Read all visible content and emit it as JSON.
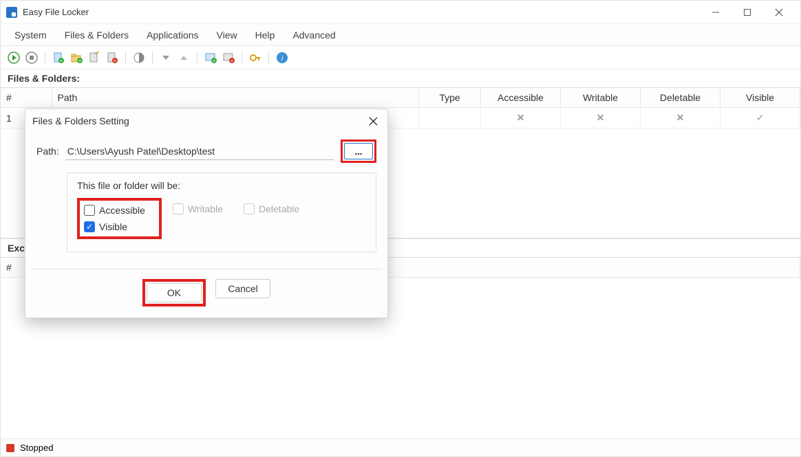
{
  "titlebar": {
    "title": "Easy File Locker"
  },
  "menubar": {
    "items": [
      "System",
      "Files & Folders",
      "Applications",
      "View",
      "Help",
      "Advanced"
    ]
  },
  "sections": {
    "files_label": "Files & Folders:",
    "excludes_label": "Exce"
  },
  "table": {
    "cols": {
      "num": "#",
      "path": "Path",
      "type": "Type",
      "accessible": "Accessible",
      "writable": "Writable",
      "deletable": "Deletable",
      "visible": "Visible"
    },
    "row1": {
      "num": "1",
      "accessible": "✕",
      "writable": "✕",
      "deletable": "✕",
      "visible": "✓"
    }
  },
  "excludes": {
    "cols": {
      "num": "#"
    }
  },
  "status": {
    "text": "Stopped"
  },
  "dialog": {
    "title": "Files & Folders Setting",
    "path_label": "Path:",
    "path_value": "C:\\Users\\Ayush Patel\\Desktop\\test",
    "browse": "...",
    "opts_hdr": "This file or folder will be:",
    "chk_accessible": "Accessible",
    "chk_writable": "Writable",
    "chk_deletable": "Deletable",
    "chk_visible": "Visible",
    "ok": "OK",
    "cancel": "Cancel"
  }
}
